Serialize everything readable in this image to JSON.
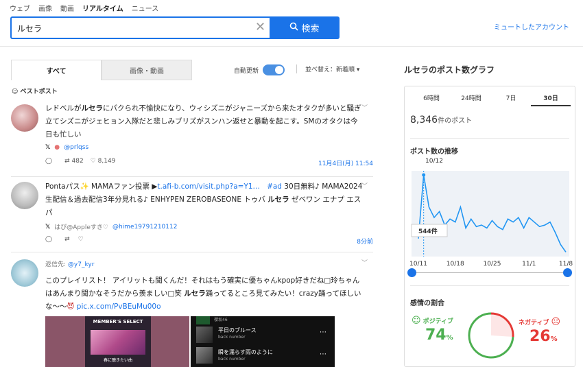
{
  "nav": {
    "items": [
      "ウェブ",
      "画像",
      "動画",
      "リアルタイム",
      "ニュース"
    ]
  },
  "search": {
    "value": "ルセラ",
    "button_label": "検索"
  },
  "muted_link": "ミュートしたアカウント",
  "tabs": {
    "all": "すべて",
    "media": "画像・動画"
  },
  "auto_refresh": "自動更新",
  "sort_label": "並べ替え：新着順",
  "best_posts": "ベストポスト",
  "posts": [
    {
      "text_a": "レドベルが",
      "text_b": "ルセラ",
      "text_c": "にパクられ不愉快になり、ウィシズニがジャニーズから来たオタクが多いと騒ぎ立てシズニがジェヒョン入隊だと悲しみブリズがスンハン返せと暴動を起こす。SMのオタクは今日も忙しい",
      "handle": "@prlqss",
      "reposts": "482",
      "likes": "8,149",
      "time": "11月4日(月) 11:54"
    },
    {
      "text_a": "Pontaパス",
      "text_b": " MAMAファン投票 ▶",
      "link": "t.afi-b.com/visit.php?a=Y1…",
      "hashtag": "#ad",
      "text_c": " 30日無料♪ MAMA2024生配信＆過去配信3年分見れる♪ ENHYPEN ZEROBASEONE トゥバ ",
      "bold": "ルセラ",
      "text_d": " ゼベワン エナプ エスパ",
      "user": "はぴ@Appleすき♡",
      "handle": "@hime19791210112",
      "time": "8分前"
    },
    {
      "reply_to_label": "返信先:",
      "reply_to": "@y7_kyr",
      "text_a": "このプレイリスト！ アイリットも聞くんだ！それはもう確実に優ちゃんkpop好きだね□玲ちゃんはあんまり聞かなそうだから羨ましい□笑 ",
      "bold": "ルセラ",
      "text_b": "踊ってるところ見てみたい！crazy踊ってほしいな〜〜",
      "link": "pic.x.com/PvBEuMu00o",
      "media": {
        "left_title": "MEMBER'S SELECT",
        "left_sub": "春に聴きたい曲",
        "tracks": [
          {
            "title": "平日のブルース",
            "artist": "back number"
          },
          {
            "title": "瞬を濡らす雨のように",
            "artist": "back number"
          }
        ],
        "top_label": "櫻坂46"
      }
    }
  ],
  "right": {
    "title": "ルセラのポスト数グラフ",
    "range_tabs": [
      "6時間",
      "24時間",
      "7日",
      "30日"
    ],
    "total_value": "8,346",
    "total_unit": "件のポスト",
    "trend_title": "ポスト数の推移",
    "sentiment_title": "感情の割合",
    "positive_label": "ポジティブ",
    "positive_value": "74",
    "negative_label": "ネガティブ",
    "negative_value": "26",
    "percent": "%",
    "colors": {
      "positive": "#4caf50",
      "negative": "#e53935",
      "line": "#2196f3"
    }
  },
  "chart_data": {
    "type": "line",
    "title": "ポスト数の推移",
    "x_ticks": [
      "10/11",
      "10/18",
      "10/25",
      "11/1",
      "11/8"
    ],
    "peak_date_label": "10/12",
    "tooltip_value": "544件",
    "x": [
      "10/11",
      "10/12",
      "10/13",
      "10/14",
      "10/15",
      "10/16",
      "10/17",
      "10/18",
      "10/19",
      "10/20",
      "10/21",
      "10/22",
      "10/23",
      "10/24",
      "10/25",
      "10/26",
      "10/27",
      "10/28",
      "10/29",
      "10/30",
      "10/31",
      "11/1",
      "11/2",
      "11/3",
      "11/4",
      "11/5",
      "11/6",
      "11/7",
      "11/8"
    ],
    "y": [
      120,
      544,
      330,
      260,
      300,
      210,
      250,
      230,
      330,
      190,
      250,
      200,
      210,
      190,
      240,
      200,
      180,
      250,
      230,
      260,
      190,
      260,
      230,
      200,
      210,
      230,
      160,
      80,
      30
    ],
    "grid": false
  }
}
